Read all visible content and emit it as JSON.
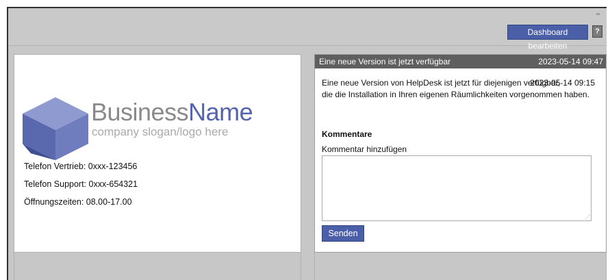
{
  "toolbar": {
    "edit_dashboard_label": "Dashboard bearbeiten",
    "help_label": "?",
    "resize_glyph": "⇹"
  },
  "company_widget": {
    "brand_prefix": "Business",
    "brand_suffix": "Name",
    "slogan": "company slogan/logo here",
    "phone_sales": "Telefon Vertrieb: 0xxx-123456",
    "phone_support": "Telefon Support: 0xxx-654321",
    "opening_hours": "Öffnungszeiten: 08.00-17.00"
  },
  "news_widget": {
    "title": "Eine neue Version ist jetzt verfügbar",
    "date": "2023-05-14 09:47",
    "message_line1": "Eine neue Version von HelpDesk ist jetzt für diejenigen verfügbar,",
    "message_line2": "die die Installation in Ihren eigenen Räumlichkeiten vorgenommen haben.",
    "message_date": "2023-05-14 09:15",
    "comments_heading": "Kommentare",
    "add_comment_label": "Kommentar hinzufügen",
    "comment_value": "",
    "send_label": "Senden"
  },
  "colors": {
    "accent": "#4a5fa8",
    "header_bg": "#5f5f5f",
    "page_bg": "#c7c7c7",
    "brand_blue": "#5565ad"
  },
  "icons": [
    "resize-icon",
    "help-icon",
    "cube-logo-icon",
    "textarea-grip-icon"
  ]
}
